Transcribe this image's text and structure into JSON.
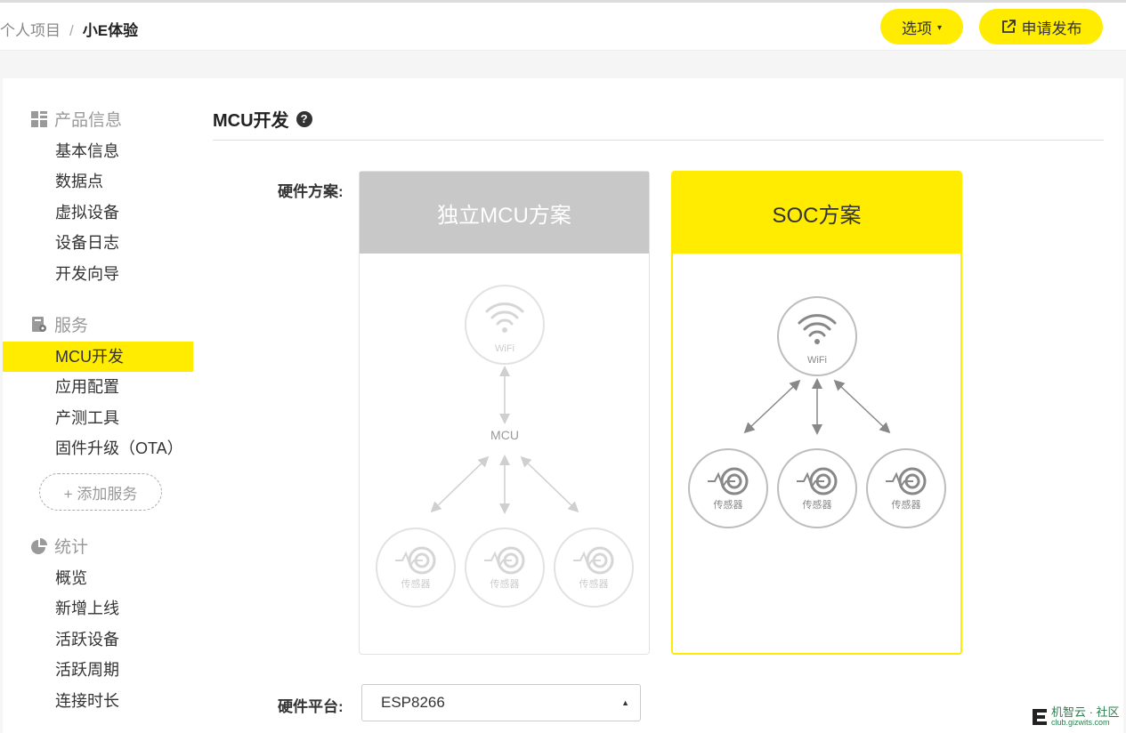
{
  "breadcrumb": {
    "parent": "个人项目",
    "separator": "/",
    "current": "小E体验"
  },
  "header": {
    "options_label": "选项",
    "publish_label": "申请发布"
  },
  "sidebar": {
    "groups": [
      {
        "label": "产品信息",
        "icon": "product-grid-icon",
        "items": [
          "基本信息",
          "数据点",
          "虚拟设备",
          "设备日志",
          "开发向导"
        ]
      },
      {
        "label": "服务",
        "icon": "service-icon",
        "items": [
          "MCU开发",
          "应用配置",
          "产测工具",
          "固件升级（OTA）"
        ]
      },
      {
        "label": "统计",
        "icon": "pie-chart-icon",
        "items": [
          "概览",
          "新增上线",
          "活跃设备",
          "活跃周期",
          "连接时长"
        ]
      }
    ],
    "active_item": "MCU开发",
    "add_service": "+ 添加服务"
  },
  "main": {
    "title": "MCU开发",
    "hardware_scheme_label": "硬件方案:",
    "schemes": [
      {
        "title": "独立MCU方案",
        "wifi": "WiFi",
        "mcu": "MCU",
        "sensor": "传感器",
        "selected": false
      },
      {
        "title": "SOC方案",
        "wifi": "WiFi",
        "sensor": "传感器",
        "selected": true
      }
    ],
    "hardware_platform_label": "硬件平台:",
    "hardware_platform_value": "ESP8266"
  },
  "watermark": {
    "title": "机智云 · 社区",
    "subtitle": "club.gizwits.com"
  },
  "colors": {
    "accent": "#ffec00",
    "disabled_gray": "#c8c8c8"
  }
}
